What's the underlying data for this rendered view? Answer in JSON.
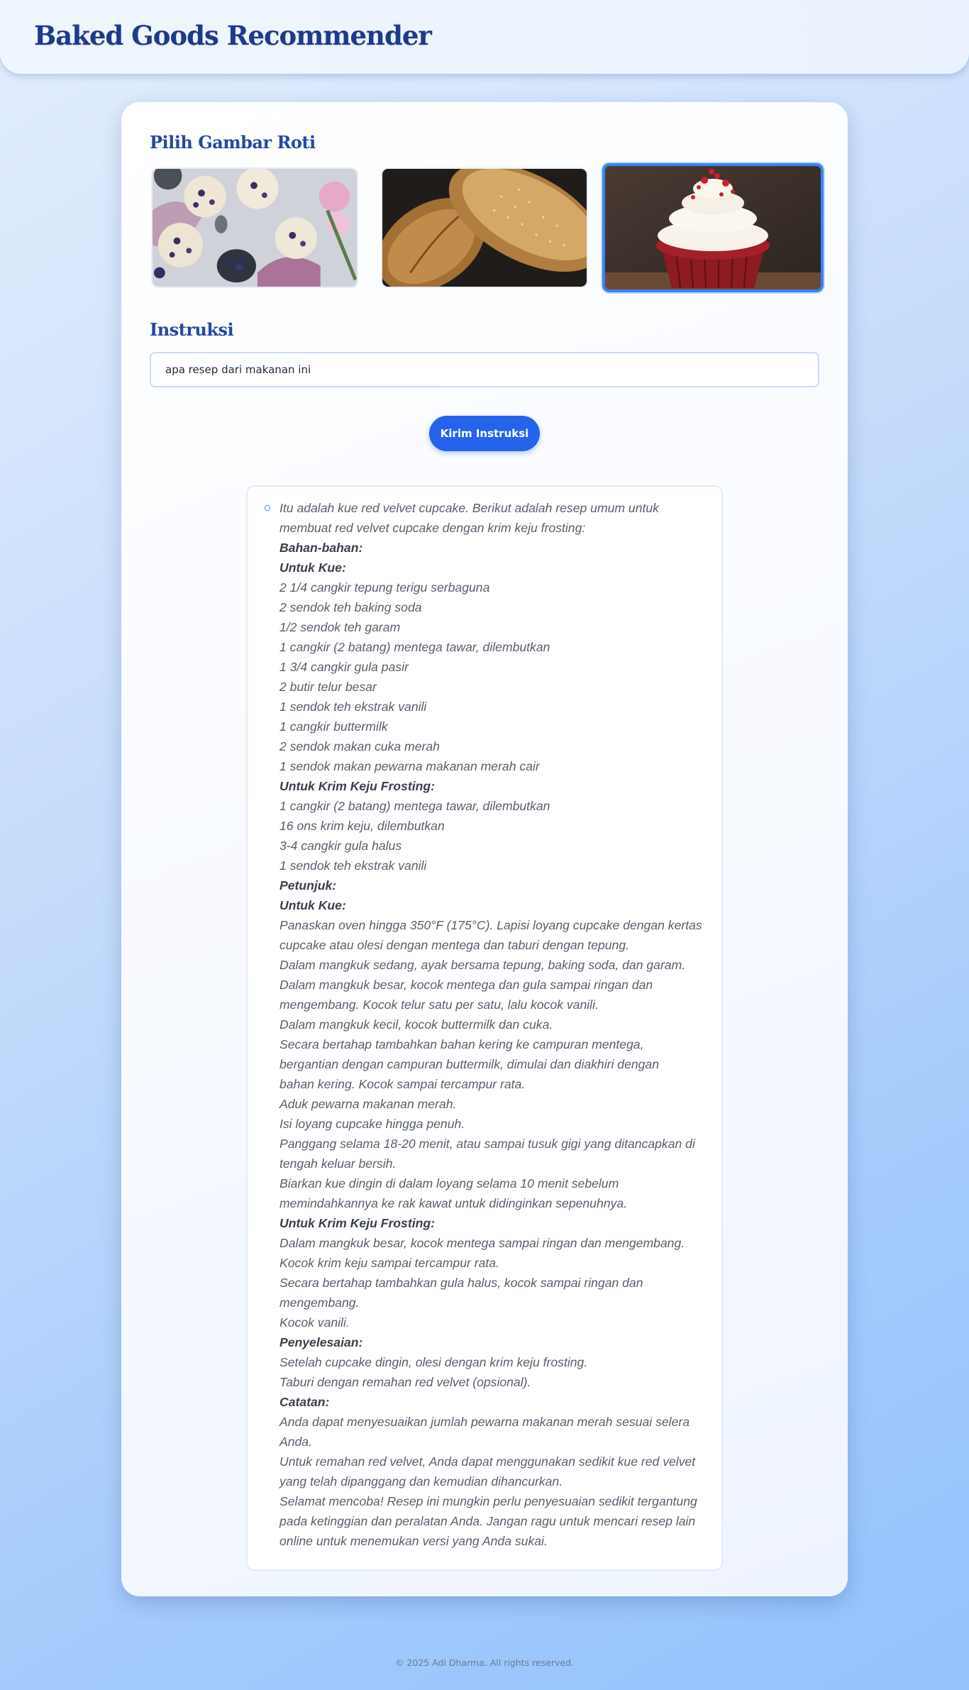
{
  "header": {
    "title": "Baked Goods Recommender"
  },
  "gallery": {
    "title": "Pilih Gambar Roti",
    "images": [
      {
        "subject": "blueberry scones with blueberries",
        "selected": false
      },
      {
        "subject": "crusty bread loaves",
        "selected": false
      },
      {
        "subject": "red velvet cupcake with cream cheese frosting",
        "selected": true
      }
    ]
  },
  "instruction": {
    "title": "Instruksi",
    "value": "apa resep dari makanan ini",
    "button_label": "Kirim Instruksi"
  },
  "result": {
    "lines": [
      {
        "text": "Itu adalah kue red velvet cupcake. Berikut adalah resep umum untuk",
        "bold": false
      },
      {
        "text": "membuat red velvet cupcake dengan krim keju frosting:",
        "bold": false
      },
      {
        "text": "Bahan-bahan:",
        "bold": true
      },
      {
        "text": "Untuk Kue:",
        "bold": true
      },
      {
        "text": "2 1/4 cangkir tepung terigu serbaguna",
        "bold": false
      },
      {
        "text": "2 sendok teh baking soda",
        "bold": false
      },
      {
        "text": "1/2 sendok teh garam",
        "bold": false
      },
      {
        "text": "1 cangkir (2 batang) mentega tawar, dilembutkan",
        "bold": false
      },
      {
        "text": "1 3/4 cangkir gula pasir",
        "bold": false
      },
      {
        "text": "2 butir telur besar",
        "bold": false
      },
      {
        "text": "1 sendok teh ekstrak vanili",
        "bold": false
      },
      {
        "text": "1 cangkir buttermilk",
        "bold": false
      },
      {
        "text": "2 sendok makan cuka merah",
        "bold": false
      },
      {
        "text": "1 sendok makan pewarna makanan merah cair",
        "bold": false
      },
      {
        "text": "Untuk Krim Keju Frosting:",
        "bold": true
      },
      {
        "text": "1 cangkir (2 batang) mentega tawar, dilembutkan",
        "bold": false
      },
      {
        "text": "16 ons krim keju, dilembutkan",
        "bold": false
      },
      {
        "text": "3-4 cangkir gula halus",
        "bold": false
      },
      {
        "text": "1 sendok teh ekstrak vanili",
        "bold": false
      },
      {
        "text": "Petunjuk:",
        "bold": true
      },
      {
        "text": "Untuk Kue:",
        "bold": true
      },
      {
        "text": "Panaskan oven hingga 350°F (175°C). Lapisi loyang cupcake dengan kertas",
        "bold": false
      },
      {
        "text": "cupcake atau olesi dengan mentega dan taburi dengan tepung.",
        "bold": false
      },
      {
        "text": "Dalam mangkuk sedang, ayak bersama tepung, baking soda, dan garam.",
        "bold": false
      },
      {
        "text": "Dalam mangkuk besar, kocok mentega dan gula sampai ringan dan",
        "bold": false
      },
      {
        "text": "mengembang. Kocok telur satu per satu, lalu kocok vanili.",
        "bold": false
      },
      {
        "text": "Dalam mangkuk kecil, kocok buttermilk dan cuka.",
        "bold": false
      },
      {
        "text": "Secara bertahap tambahkan bahan kering ke campuran mentega,",
        "bold": false
      },
      {
        "text": "bergantian dengan campuran buttermilk, dimulai dan diakhiri dengan",
        "bold": false
      },
      {
        "text": "bahan kering. Kocok sampai tercampur rata.",
        "bold": false
      },
      {
        "text": "Aduk pewarna makanan merah.",
        "bold": false
      },
      {
        "text": "Isi loyang cupcake hingga penuh.",
        "bold": false
      },
      {
        "text": "Panggang selama 18-20 menit, atau sampai tusuk gigi yang ditancapkan di",
        "bold": false
      },
      {
        "text": "tengah keluar bersih.",
        "bold": false
      },
      {
        "text": "Biarkan kue dingin di dalam loyang selama 10 menit sebelum",
        "bold": false
      },
      {
        "text": "memindahkannya ke rak kawat untuk didinginkan sepenuhnya.",
        "bold": false
      },
      {
        "text": "Untuk Krim Keju Frosting:",
        "bold": true
      },
      {
        "text": "Dalam mangkuk besar, kocok mentega sampai ringan dan mengembang.",
        "bold": false
      },
      {
        "text": "Kocok krim keju sampai tercampur rata.",
        "bold": false
      },
      {
        "text": "Secara bertahap tambahkan gula halus, kocok sampai ringan dan",
        "bold": false
      },
      {
        "text": "mengembang.",
        "bold": false
      },
      {
        "text": "Kocok vanili.",
        "bold": false
      },
      {
        "text": "Penyelesaian:",
        "bold": true
      },
      {
        "text": "Setelah cupcake dingin, olesi dengan krim keju frosting.",
        "bold": false
      },
      {
        "text": "Taburi dengan remahan red velvet (opsional).",
        "bold": false
      },
      {
        "text": "Catatan:",
        "bold": true
      },
      {
        "text": "Anda dapat menyesuaikan jumlah pewarna makanan merah sesuai selera",
        "bold": false
      },
      {
        "text": "Anda.",
        "bold": false
      },
      {
        "text": "Untuk remahan red velvet, Anda dapat menggunakan sedikit kue red velvet",
        "bold": false
      },
      {
        "text": "yang telah dipanggang dan kemudian dihancurkan.",
        "bold": false
      },
      {
        "text": "Selamat mencoba! Resep ini mungkin perlu penyesuaian sedikit tergantung",
        "bold": false
      },
      {
        "text": "pada ketinggian dan peralatan Anda. Jangan ragu untuk mencari resep lain",
        "bold": false
      },
      {
        "text": "online untuk menemukan versi yang Anda sukai.",
        "bold": false
      }
    ]
  },
  "footer": {
    "text": "© 2025 Adi Dharma. All rights reserved."
  },
  "colors": {
    "accent": "#2563eb",
    "title": "#1e3a8a",
    "selected_border": "#3b82f6"
  }
}
